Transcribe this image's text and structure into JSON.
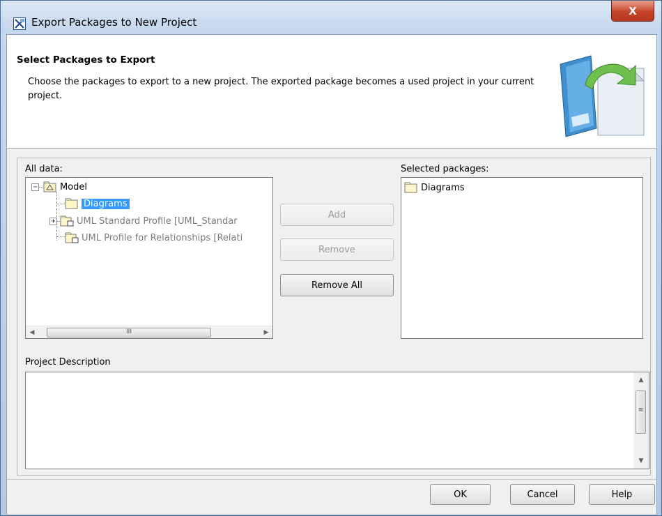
{
  "window": {
    "title": "Export Packages to New Project",
    "close_label": "X"
  },
  "banner": {
    "title": "Select Packages to Export",
    "description": "Choose the packages to export to a new project. The exported package becomes a used project in your current project."
  },
  "all_data": {
    "label": "All data:",
    "tree": {
      "root": "Model",
      "items": [
        {
          "label": "Diagrams",
          "selected": true,
          "enabled": true
        },
        {
          "label": "UML Standard Profile [UML_Standar",
          "selected": false,
          "enabled": false
        },
        {
          "label": "UML Profile for Relationships [Relati",
          "selected": false,
          "enabled": false
        }
      ]
    },
    "hscroll_thumb_grip": "III"
  },
  "actions": {
    "add": "Add",
    "remove": "Remove",
    "remove_all": "Remove All"
  },
  "selected_packages": {
    "label": "Selected packages:",
    "items": [
      "Diagrams"
    ]
  },
  "project_description": {
    "label": "Project Description",
    "value": ""
  },
  "footer": {
    "ok": "OK",
    "cancel": "Cancel",
    "help": "Help"
  },
  "colors": {
    "selection": "#3399ff",
    "close_button": "#c4442a",
    "folder_fill": "#fff6c9"
  },
  "icons": {
    "title": "export-dialog-icon",
    "folder": "folder-icon",
    "model": "model-package-icon",
    "profile": "profile-package-icon"
  }
}
